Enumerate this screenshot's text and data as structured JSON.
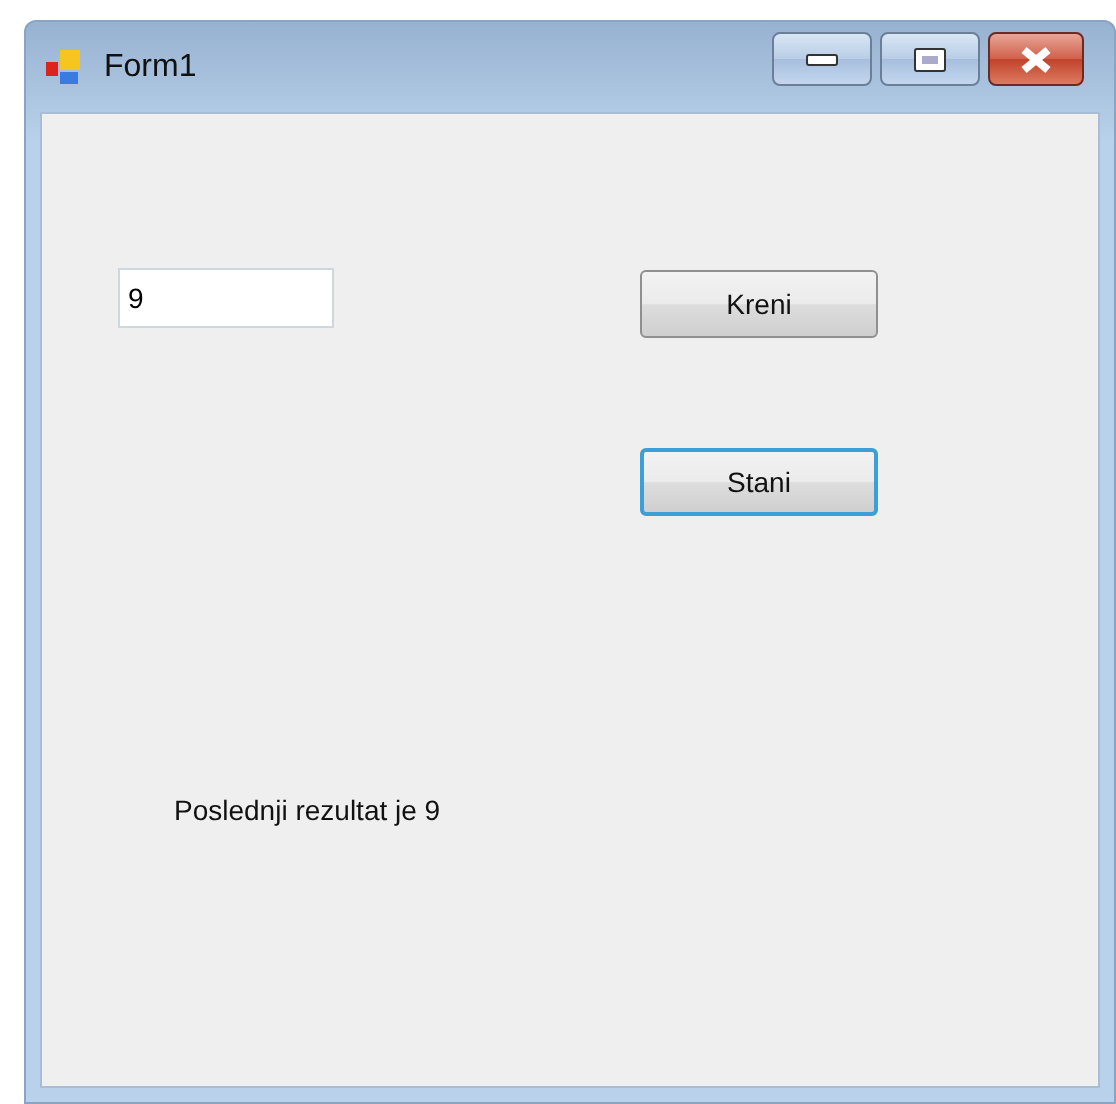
{
  "window": {
    "title": "Form1"
  },
  "textbox": {
    "value": "9"
  },
  "buttons": [
    {
      "label": "Kreni",
      "focused": false
    },
    {
      "label": "Stani",
      "focused": true
    }
  ],
  "result_label": "Poslednji rezultat je 9"
}
